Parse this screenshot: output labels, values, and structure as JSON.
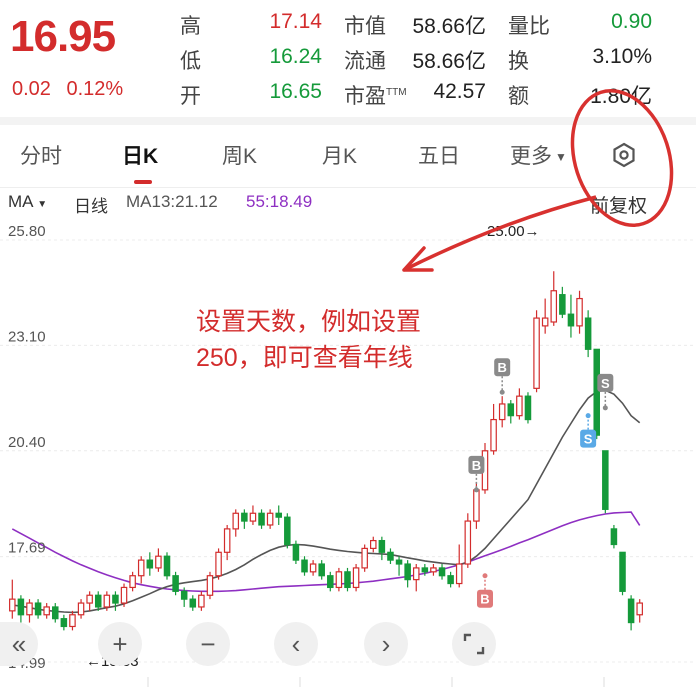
{
  "quote": {
    "price": "16.95",
    "change": "0.02",
    "change_pct": "0.12%",
    "rows": [
      {
        "label": "高",
        "value": "17.14"
      },
      {
        "label": "低",
        "value": "16.24"
      },
      {
        "label": "开",
        "value": "16.65"
      }
    ],
    "mid": [
      {
        "label": "市值",
        "value": "58.66亿"
      },
      {
        "label": "流通",
        "value": "58.66亿"
      },
      {
        "label": "市盈",
        "sup": "TTM",
        "value": "42.57"
      }
    ],
    "right": [
      {
        "label": "量比",
        "value": "0.90"
      },
      {
        "label": "换",
        "value": "3.10%"
      },
      {
        "label": "额",
        "value": "1.80亿"
      }
    ]
  },
  "tabs": [
    "分时",
    "日K",
    "周K",
    "月K",
    "五日",
    "更多"
  ],
  "ma_row": {
    "ma_select": "MA",
    "period": "日线",
    "ma13": "MA13:21.12",
    "ma55": "55:18.49",
    "adjust": "前复权"
  },
  "colors": {
    "up": "#d32c2c",
    "down": "#159a3a",
    "ma13": "#555555",
    "ma55": "#8e2fc2",
    "annotation": "#d32c2c"
  },
  "annotation": {
    "line1": "设置天数，例如设置",
    "line2": "250，即可查看年线"
  },
  "icons": [
    "hexagon-settings-icon",
    "double-left-icon",
    "plus-icon",
    "minus-icon",
    "chevron-left-icon",
    "chevron-right-icon",
    "fullscreen-icon"
  ],
  "chart_data": {
    "type": "candlestick",
    "y_ticks": [
      "25.80",
      "23.10",
      "20.40",
      "17.69",
      "14.99"
    ],
    "ylim": [
      14.99,
      25.8
    ],
    "high_label": "25.00→",
    "low_label": "←15.83",
    "candles": [
      [
        16.3,
        16.6,
        17.1,
        16.1
      ],
      [
        16.6,
        16.2,
        16.7,
        16.0
      ],
      [
        16.2,
        16.5,
        16.6,
        16.0
      ],
      [
        16.5,
        16.2,
        16.6,
        16.1
      ],
      [
        16.2,
        16.4,
        16.5,
        16.1
      ],
      [
        16.4,
        16.1,
        16.5,
        16.0
      ],
      [
        16.1,
        15.9,
        16.2,
        15.8
      ],
      [
        15.9,
        16.2,
        16.3,
        15.8
      ],
      [
        16.2,
        16.5,
        16.6,
        16.1
      ],
      [
        16.5,
        16.7,
        16.8,
        16.3
      ],
      [
        16.7,
        16.4,
        16.8,
        16.3
      ],
      [
        16.4,
        16.7,
        16.8,
        16.3
      ],
      [
        16.7,
        16.5,
        16.8,
        16.3
      ],
      [
        16.5,
        16.9,
        17.0,
        16.4
      ],
      [
        16.9,
        17.2,
        17.3,
        16.8
      ],
      [
        17.2,
        17.6,
        17.7,
        17.0
      ],
      [
        17.6,
        17.4,
        17.8,
        17.2
      ],
      [
        17.4,
        17.7,
        17.9,
        17.3
      ],
      [
        17.7,
        17.2,
        17.8,
        17.1
      ],
      [
        17.2,
        16.8,
        17.3,
        16.7
      ],
      [
        16.8,
        16.6,
        16.9,
        16.4
      ],
      [
        16.6,
        16.4,
        16.7,
        16.3
      ],
      [
        16.4,
        16.7,
        16.8,
        16.3
      ],
      [
        16.7,
        17.2,
        17.3,
        16.6
      ],
      [
        17.2,
        17.8,
        17.9,
        17.1
      ],
      [
        17.8,
        18.4,
        18.5,
        17.6
      ],
      [
        18.4,
        18.8,
        18.9,
        18.2
      ],
      [
        18.8,
        18.6,
        18.9,
        18.4
      ],
      [
        18.6,
        18.8,
        19.0,
        18.5
      ],
      [
        18.8,
        18.5,
        18.9,
        18.4
      ],
      [
        18.5,
        18.8,
        18.9,
        18.4
      ],
      [
        18.8,
        18.7,
        19.0,
        18.5
      ],
      [
        18.7,
        18.0,
        18.8,
        17.9
      ],
      [
        18.0,
        17.6,
        18.1,
        17.5
      ],
      [
        17.6,
        17.3,
        17.7,
        17.2
      ],
      [
        17.3,
        17.5,
        17.6,
        17.2
      ],
      [
        17.5,
        17.2,
        17.6,
        17.1
      ],
      [
        17.2,
        16.9,
        17.3,
        16.8
      ],
      [
        16.9,
        17.3,
        17.4,
        16.8
      ],
      [
        17.3,
        16.9,
        17.4,
        16.8
      ],
      [
        16.9,
        17.4,
        17.5,
        16.8
      ],
      [
        17.4,
        17.9,
        18.0,
        17.3
      ],
      [
        17.9,
        18.1,
        18.2,
        17.8
      ],
      [
        18.1,
        17.8,
        18.2,
        17.6
      ],
      [
        17.8,
        17.6,
        17.9,
        17.5
      ],
      [
        17.6,
        17.5,
        17.7,
        17.2
      ],
      [
        17.5,
        17.1,
        17.6,
        16.9
      ],
      [
        17.1,
        17.4,
        17.5,
        16.8
      ],
      [
        17.4,
        17.3,
        17.5,
        17.2
      ],
      [
        17.3,
        17.4,
        17.5,
        17.2
      ],
      [
        17.4,
        17.2,
        17.5,
        17.1
      ],
      [
        17.2,
        17.0,
        17.3,
        16.9
      ],
      [
        17.0,
        17.5,
        18.0,
        16.9
      ],
      [
        17.5,
        18.6,
        18.8,
        17.4
      ],
      [
        18.6,
        19.4,
        19.6,
        18.4
      ],
      [
        19.4,
        20.4,
        20.6,
        19.3
      ],
      [
        20.4,
        21.2,
        21.6,
        20.3
      ],
      [
        21.2,
        21.6,
        21.8,
        21.0
      ],
      [
        21.6,
        21.3,
        21.7,
        21.1
      ],
      [
        21.3,
        21.8,
        22.0,
        21.2
      ],
      [
        21.8,
        21.2,
        21.9,
        21.1
      ],
      [
        22.0,
        23.8,
        24.0,
        21.9
      ],
      [
        23.6,
        23.8,
        24.3,
        23.4
      ],
      [
        23.7,
        24.5,
        25.0,
        23.6
      ],
      [
        24.4,
        23.9,
        24.6,
        23.8
      ],
      [
        23.9,
        23.6,
        24.4,
        23.3
      ],
      [
        23.6,
        24.3,
        24.5,
        23.4
      ],
      [
        23.8,
        23.0,
        24.0,
        22.8
      ],
      [
        23.0,
        20.8,
        23.0,
        20.7
      ],
      [
        20.4,
        18.9,
        20.4,
        18.8
      ],
      [
        18.4,
        18.0,
        18.5,
        17.9
      ],
      [
        17.8,
        16.8,
        17.8,
        16.7
      ],
      [
        16.6,
        16.0,
        16.7,
        15.8
      ],
      [
        16.2,
        16.5,
        16.6,
        16.0
      ]
    ],
    "ma13": [
      16.45,
      16.42,
      16.38,
      16.34,
      16.31,
      16.29,
      16.27,
      16.26,
      16.27,
      16.3,
      16.34,
      16.38,
      16.42,
      16.48,
      16.56,
      16.65,
      16.74,
      16.84,
      16.92,
      16.98,
      17.02,
      17.05,
      17.08,
      17.12,
      17.18,
      17.26,
      17.36,
      17.48,
      17.62,
      17.74,
      17.85,
      17.93,
      17.98,
      18.0,
      17.99,
      17.96,
      17.92,
      17.88,
      17.85,
      17.82,
      17.8,
      17.78,
      17.77,
      17.76,
      17.74,
      17.7,
      17.66,
      17.62,
      17.58,
      17.55,
      17.52,
      17.5,
      17.48,
      17.55,
      17.7,
      17.9,
      18.15,
      18.4,
      18.65,
      18.9,
      19.15,
      19.55,
      19.95,
      20.35,
      20.75,
      21.1,
      21.45,
      21.75,
      21.92,
      21.95,
      21.85,
      21.62,
      21.3,
      21.12
    ],
    "ma55": [
      18.4,
      18.28,
      18.16,
      18.04,
      17.92,
      17.8,
      17.69,
      17.58,
      17.48,
      17.39,
      17.3,
      17.22,
      17.15,
      17.08,
      17.02,
      16.97,
      16.93,
      16.89,
      16.86,
      16.84,
      16.82,
      16.81,
      16.8,
      16.8,
      16.8,
      16.81,
      16.82,
      16.84,
      16.86,
      16.88,
      16.9,
      16.92,
      16.93,
      16.94,
      16.95,
      16.96,
      16.97,
      16.98,
      16.99,
      17.0,
      17.02,
      17.04,
      17.06,
      17.09,
      17.12,
      17.15,
      17.18,
      17.22,
      17.26,
      17.31,
      17.36,
      17.42,
      17.48,
      17.55,
      17.63,
      17.71,
      17.79,
      17.87,
      17.95,
      18.04,
      18.12,
      18.21,
      18.3,
      18.39,
      18.48,
      18.56,
      18.63,
      18.69,
      18.74,
      18.78,
      18.81,
      18.82,
      18.83,
      18.49
    ],
    "signals": [
      {
        "label": "B",
        "index": 57,
        "value": 21.9,
        "pos": "above"
      },
      {
        "label": "S",
        "index": 67,
        "value": 21.3,
        "pos": "below"
      },
      {
        "label": "S",
        "index": 69,
        "value": 21.5,
        "pos": "above"
      },
      {
        "label": "B",
        "index": 54,
        "value": 19.4,
        "pos": "above"
      },
      {
        "label": "B",
        "index": 55,
        "value": 17.2,
        "pos": "below"
      }
    ]
  }
}
